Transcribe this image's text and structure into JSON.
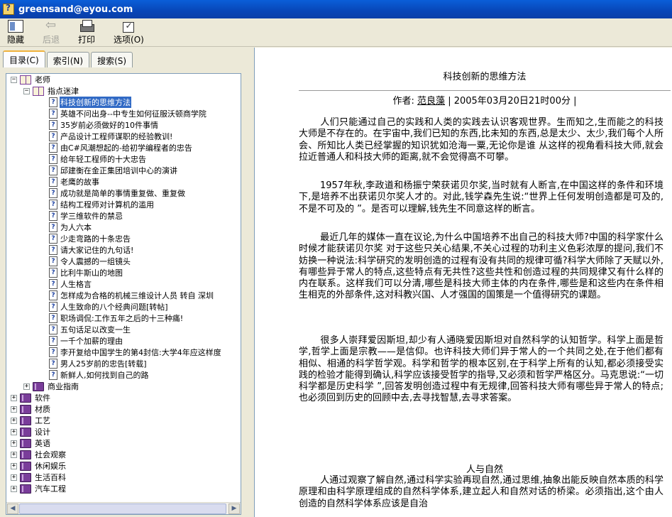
{
  "window": {
    "title": "greensand@eyou.com"
  },
  "toolbar": {
    "hide": "隐藏",
    "back": "后退",
    "print": "打印",
    "options": "选项(O)"
  },
  "tabs": {
    "contents": "目录(C)",
    "index": "索引(N)",
    "search": "搜索(S)"
  },
  "tree": {
    "root": "老师",
    "sub": "指点迷津",
    "items": [
      "科技创新的思维方法",
      "英雄不问出身--中专生如何征服沃顿商学院",
      "35岁前必须做好的10件事情",
      "产品设计工程师谋职的经验教训!",
      "由C#风潮想起的-给初学编程者的忠告",
      "给年轻工程师的十大忠告",
      "邱建衡在金正集团培训中心的演讲",
      "老鹰的故事",
      "成功就是简单的事情重复做、重复做",
      "结构工程师对计算机的滥用",
      "学三维软件的禁忌",
      "为人六本",
      "少走弯路的十条忠告",
      "请大家记住的九句话!",
      "令人震撼的一组镜头",
      "比利牛斯山的地图",
      "人生格言",
      "怎样成为合格的机械三维设计人员  转自  深圳",
      "人生致命的八个经典问题[转帖]",
      "职场调侃:工作五年之后的十三种痛!",
      "五句话足以改变一生",
      "一千个加薪的理由",
      "李开复给中国学生的第4封信:大学4年应这样度",
      "男人25岁前的忠告[转载]",
      "新鲜人,如何找到自己的路"
    ],
    "sibling": "商业指南",
    "top": [
      "软件",
      "材质",
      "工艺",
      "设计",
      "英语",
      "社会观察",
      "休闲娱乐",
      "生活百科",
      "汽车工程"
    ]
  },
  "article": {
    "title": "科技创新的思维方法",
    "byline_prefix": "作者:",
    "author": "范良藻",
    "byline_suffix": "| 2005年03月20日21时00分 |",
    "paragraphs": [
      "人们只能通过自己的实践和人类的实践去认识客观世界。生而知之,生而能之的科技大师是不存在的。在宇宙中,我们已知的东西,比未知的东西,总是太少、太少,我们每个人所会、所知比人类已经掌握的知识犹如沧海一粟,无论你是谁  从这样的视角看科技大师,就会拉近普通人和科技大师的距离,就不会觉得高不可攀。",
      "1957年秋,李政道和杨振宁荣获诺贝尔奖,当时就有人断言,在中国这样的条件和环境下,是培养不出获诺贝尔奖人才的。对此,钱学森先生说:“世界上任何发明创造都是可及的,不是不可及的 ”。是否可以理解,钱先生不同意这样的断言。",
      "最近几年的媒体一直在议论,为什么中国培养不出自己的科技大师?中国的科学家什么时候才能获诺贝尔奖  对于这些只关心结果,不关心过程的功利主义色彩浓厚的提问,我们不妨换一种说法:科学研究的发明创造的过程有没有共同的规律可循?科学大师除了天赋以外,有哪些异于常人的特点,这些特点有无共性?这些共性和创造过程的共同规律又有什么样的内在联系。这样我们可以分清,哪些是科技大师主体的内在条件,哪些是和这些内在条件相生相克的外部条件,这对科教兴国、人才强国的国策是一个值得研究的课题。",
      "很多人崇拜爱因斯坦,却少有人通晓爱因斯坦对自然科学的认知哲学。科学上面是哲学,哲学上面是宗教——是信仰。也许科技大师们异于常人的一个共同之处,在于他们都有相似、相通的科学哲学观。科学和哲学的根本区别,在于科学上所有的认知,都必须接受实践的检验才能得到确认,科学应该接受哲学的指导,又必须和哲学严格区分。马克思说:“一切科学都是历史科学 ”,回答发明创造过程中有无规律,回答科技大师有哪些异于常人的特点;也必须回到历史的回顾中去,去寻找智慧,去寻求答案。"
    ],
    "section2_title": "人与自然",
    "section2_para": "人通过观察了解自然,通过科学实验再现自然,通过思维,抽象出能反映自然本质的科学原理和由科学原理组成的自然科学体系,建立起人和自然对话的桥梁。必须指出,这个由人创造的自然科学体系应该是自治"
  }
}
